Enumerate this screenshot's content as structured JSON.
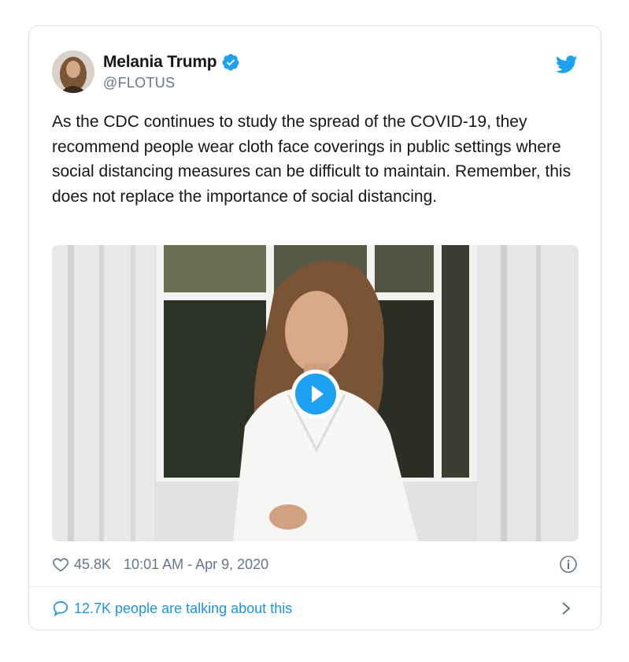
{
  "author": {
    "name": "Melania Trump",
    "handle": "@FLOTUS",
    "verified": true,
    "avatar_icon": "profile-photo"
  },
  "tweet": {
    "text": "As the CDC continues to study the spread of the COVID-19, they recommend people wear cloth face coverings in public settings where social distancing measures can be difficult to maintain. Remember, this does not replace the importance of social distancing."
  },
  "media": {
    "type": "video",
    "icon": "play-icon"
  },
  "meta": {
    "likes": "45.8K",
    "timestamp": "10:01 AM - Apr 9, 2020"
  },
  "footer": {
    "talking": "12.7K people are talking about this"
  },
  "colors": {
    "accent": "#1da1f2",
    "link": "#1b95e0",
    "text": "#14171a",
    "muted": "#657786",
    "border": "#dde3e8"
  }
}
